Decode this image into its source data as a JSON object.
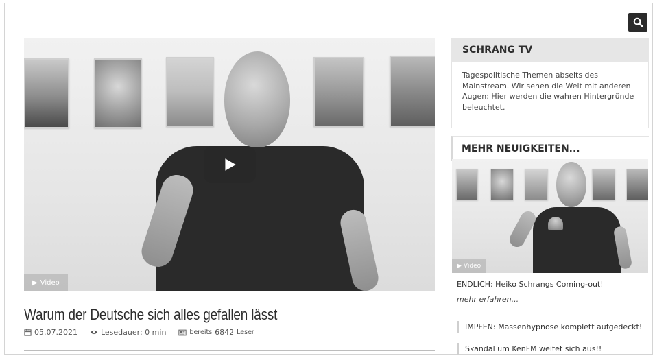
{
  "video": {
    "badge": "Video"
  },
  "article": {
    "title": "Warum der Deutsche sich alles gefallen lässt",
    "date": "05.07.2021",
    "reading_time": "Lesedauer: 0 min",
    "readers_prefix": "bereits",
    "readers_count": "6842",
    "readers_suffix": "Leser"
  },
  "sidebar": {
    "heading": "SCHRANG TV",
    "description": "Tagespolitische Themen abseits des Mainstream. Wir sehen die Welt mit anderen Augen: Hier werden die wahren Hintergründe beleuchtet.",
    "news_heading": "MEHR NEUIGKEITEN...",
    "thumb_badge": "Video",
    "feature_link": "ENDLICH: Heiko Schrangs Coming-out!",
    "more_link": "mehr erfahren...",
    "items": [
      {
        "label": "IMPFEN: Massenhypnose komplett aufgedeckt!"
      },
      {
        "label": "Skandal um KenFM weitet sich aus!!"
      }
    ]
  },
  "icons": {
    "search": "search-icon",
    "play": "play-icon",
    "calendar": "calendar-icon",
    "eye": "eye-icon",
    "newspaper": "newspaper-icon"
  },
  "colors": {
    "accent": "#2b2b2b",
    "header_bg": "#e6e6e6",
    "text": "#333333"
  }
}
